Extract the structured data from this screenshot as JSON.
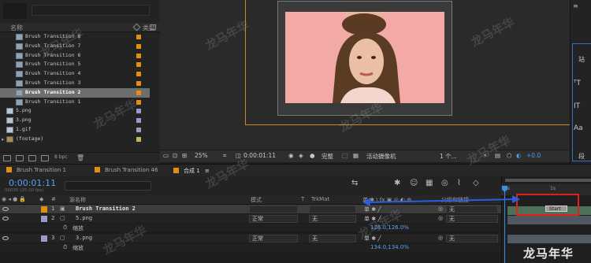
{
  "project": {
    "col_name": "名称",
    "col_type": "类型",
    "items": [
      {
        "name": "Brush Transition 8",
        "kind": "comp",
        "label_color": "#e0900e"
      },
      {
        "name": "Brush Transition 7",
        "kind": "comp",
        "label_color": "#e0900e"
      },
      {
        "name": "Brush Transition 6",
        "kind": "comp",
        "label_color": "#e0900e"
      },
      {
        "name": "Brush Transition 5",
        "kind": "comp",
        "label_color": "#e0900e"
      },
      {
        "name": "Brush Transition 4",
        "kind": "comp",
        "label_color": "#e0900e"
      },
      {
        "name": "Brush Transition 3",
        "kind": "comp",
        "label_color": "#e0900e"
      },
      {
        "name": "Brush Transition 2",
        "kind": "comp",
        "label_color": "#e0900e",
        "selected": true
      },
      {
        "name": "Brush Transition 1",
        "kind": "comp",
        "label_color": "#e0900e"
      },
      {
        "name": "5.png",
        "kind": "image",
        "label_color": "#9a9ac8"
      },
      {
        "name": "3.png",
        "kind": "image",
        "label_color": "#9a9ac8"
      },
      {
        "name": "1.gif",
        "kind": "image",
        "label_color": "#9a9ac8"
      },
      {
        "name": "(footage)",
        "kind": "folder",
        "label_color": "#c8b45a"
      }
    ],
    "footer_bpc": "8 bpc"
  },
  "viewer": {
    "zoom": "25%",
    "timecode": "0:00:01:11",
    "quality": "完整",
    "camera": "活动摄像机",
    "views": "1 个...",
    "exposure": "+0.0"
  },
  "right_panel": {
    "label_top": "站",
    "label_mid": "段"
  },
  "timeline": {
    "tabs": [
      {
        "label": "Brush Transition 1",
        "color": "#e0900e"
      },
      {
        "label": "Brush Transition 46",
        "color": "#e0900e"
      },
      {
        "label": "合成 1",
        "color": "#e0900e",
        "active": true
      }
    ],
    "timecode": "0:00:01:11",
    "fps": "00035 (25.00 fps)",
    "headers": {
      "source_name": "源名称",
      "mode": "模式",
      "t": "T",
      "trkmat": "TrkMat",
      "parent": "父级和链接"
    },
    "rows": [
      {
        "index": "1",
        "name": "Brush Transition 2",
        "kind": "comp",
        "label_color": "#e0900e",
        "mode": "",
        "trkmat": "",
        "parent": "无",
        "selected": true
      },
      {
        "index": "2",
        "name": "5.png",
        "kind": "image",
        "label_color": "#9a9ac8",
        "mode": "正常",
        "trkmat": "无",
        "parent": "无"
      },
      {
        "sub": true,
        "name": "缩放",
        "value": "126.0,126.0%"
      },
      {
        "index": "3",
        "name": "3.png",
        "kind": "image",
        "label_color": "#9a9ac8",
        "mode": "正常",
        "trkmat": "无",
        "parent": "无"
      },
      {
        "sub": true,
        "name": "缩放",
        "value": "134.0,134.0%"
      }
    ],
    "marker_label": "Start",
    "ruler_labels": [
      "0s",
      "1s"
    ]
  },
  "watermark": "龙马年华",
  "brand": "龙马年华",
  "colors": {
    "accent_blue": "#4d9cf5",
    "comp_orange": "#e0900e",
    "highlight_red": "#e0201a"
  }
}
